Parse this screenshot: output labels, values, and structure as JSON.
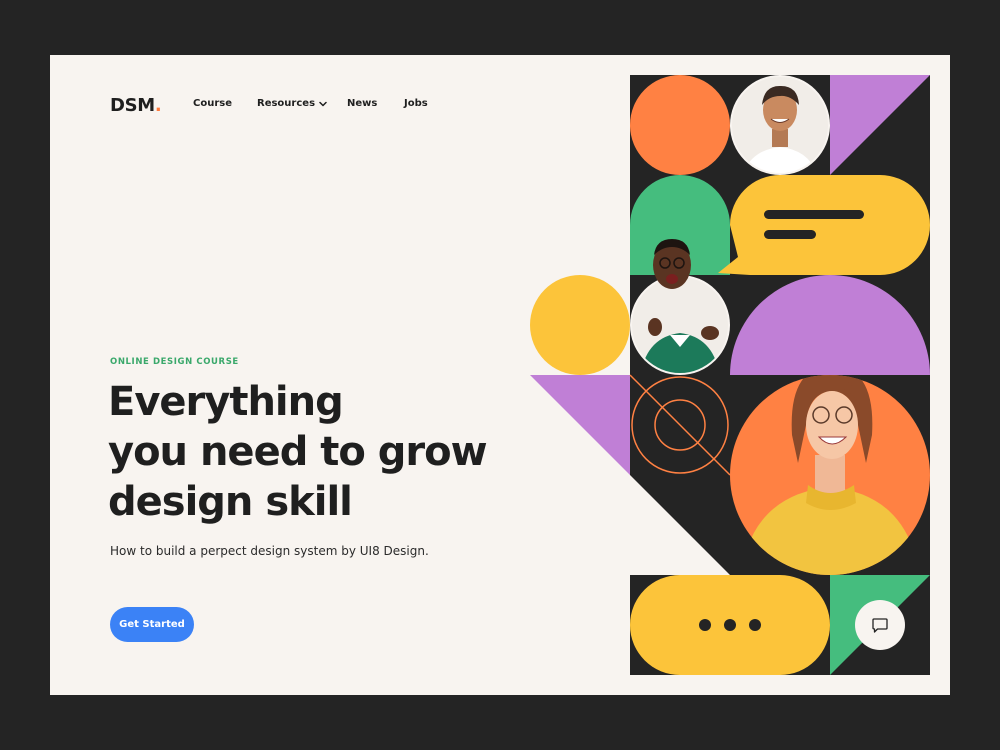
{
  "brand": {
    "name": "DSM",
    "dot": ".",
    "accent_color": "#ff7a3d"
  },
  "nav": {
    "course": "Course",
    "resources": "Resources",
    "news": "News",
    "jobs": "Jobs"
  },
  "hero": {
    "eyebrow": "ONLINE DESIGN COURSE",
    "headline_lines": [
      "Everything",
      "you need to grow",
      "design skill"
    ],
    "subtitle": "How to build a perpect design system by UI8 Design.",
    "cta_label": "Get Started",
    "cta_color": "#3b82f6",
    "eyebrow_color": "#3aa86b"
  },
  "palette": {
    "orange": "#ff8143",
    "green": "#45bd7e",
    "yellow": "#fcc43a",
    "purple": "#c07fd6",
    "dark": "#242424",
    "cream": "#f8f4f0"
  },
  "illustration": {
    "avatars": [
      "smiling-man-avatar",
      "pointing-man-avatar",
      "smiling-woman-avatar"
    ],
    "chat_icon": "chat-bubble-icon"
  }
}
